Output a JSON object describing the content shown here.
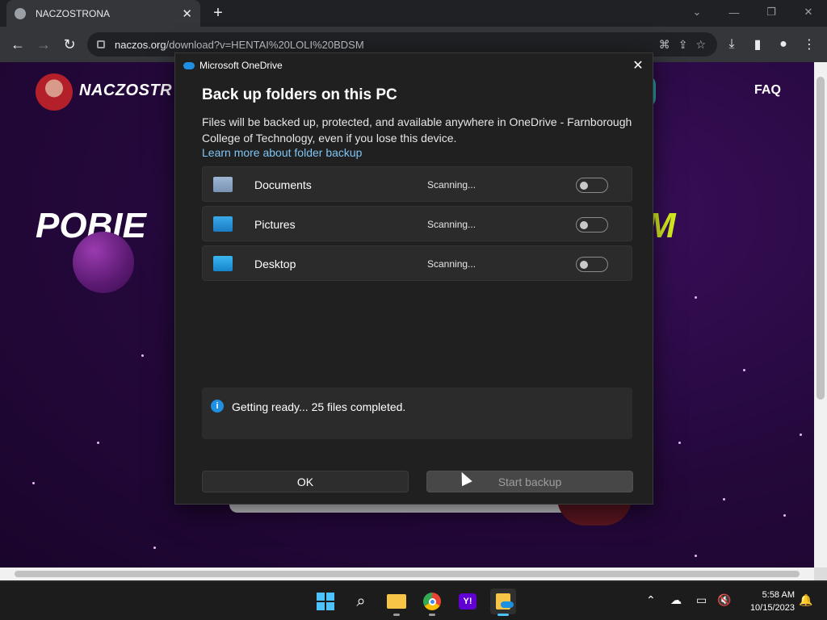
{
  "browser": {
    "tab_title": "NACZOSTRONA",
    "tab_close": "✕",
    "new_tab": "+",
    "url_domain": "naczos.org",
    "url_path": "/download?v=HENTAI%20LOLI%20BDSM"
  },
  "page": {
    "logo_text": "NACZOSTR",
    "nav_faq": "FAQ",
    "title_part1": "POBIE",
    "title_part2": "M"
  },
  "dialog": {
    "app_title": "Microsoft OneDrive",
    "close": "✕",
    "heading": "Back up folders on this PC",
    "description": "Files will be backed up, protected, and available anywhere in OneDrive - Farnborough College of Technology, even if you lose this device.",
    "learn_more_link": "Learn more about folder backup",
    "folders": [
      {
        "name": "Documents",
        "status": "Scanning...",
        "enabled": false
      },
      {
        "name": "Pictures",
        "status": "Scanning...",
        "enabled": false
      },
      {
        "name": "Desktop",
        "status": "Scanning...",
        "enabled": false
      }
    ],
    "info_text": "Getting ready... 25 files completed.",
    "ok_label": "OK",
    "start_label": "Start backup"
  },
  "taskbar": {
    "time": "5:58 AM",
    "date": "10/15/2023"
  }
}
